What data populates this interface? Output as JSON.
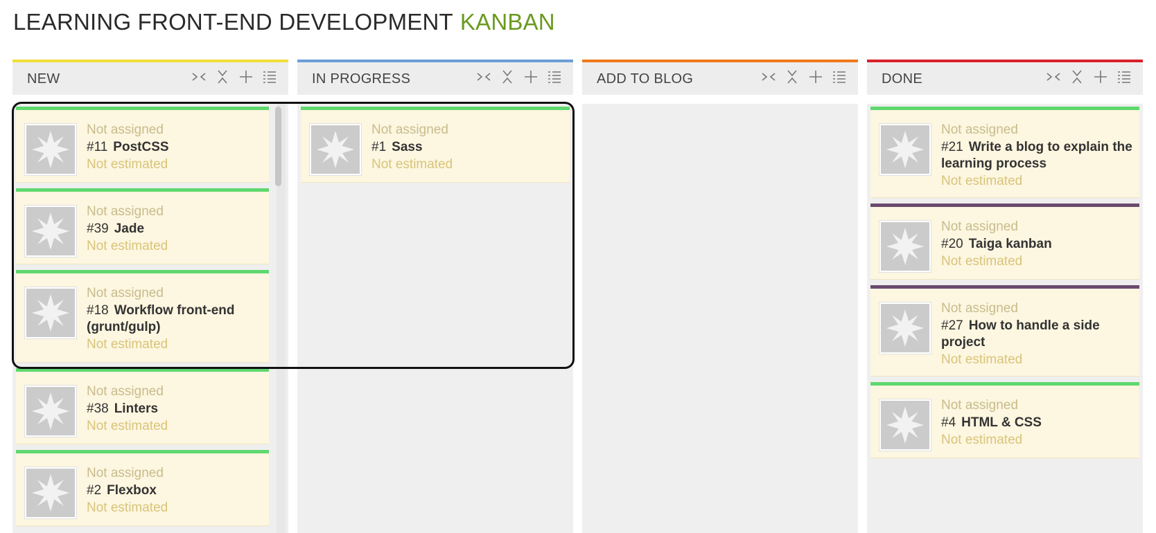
{
  "page": {
    "title": "LEARNING FRONT-END DEVELOPMENT",
    "title_accent": "KANBAN",
    "accent_color": "#6a9a1f"
  },
  "columns": [
    {
      "title": "NEW",
      "color": "#f2de3a",
      "cards": [
        {
          "assigned": "Not assigned",
          "ref": "#11",
          "name": "PostCSS",
          "estimate": "Not estimated",
          "tag_color": "#5fd86e"
        },
        {
          "assigned": "Not assigned",
          "ref": "#39",
          "name": "Jade",
          "estimate": "Not estimated",
          "tag_color": "#5fd86e"
        },
        {
          "assigned": "Not assigned",
          "ref": "#18",
          "name": "Workflow front-end (grunt/gulp)",
          "estimate": "Not estimated",
          "tag_color": "#5fd86e"
        },
        {
          "assigned": "Not assigned",
          "ref": "#38",
          "name": "Linters",
          "estimate": "Not estimated",
          "tag_color": "#5fd86e"
        },
        {
          "assigned": "Not assigned",
          "ref": "#2",
          "name": "Flexbox",
          "estimate": "Not estimated",
          "tag_color": "#5fd86e"
        }
      ]
    },
    {
      "title": "IN PROGRESS",
      "color": "#6b9ed8",
      "cards": [
        {
          "assigned": "Not assigned",
          "ref": "#1",
          "name": "Sass",
          "estimate": "Not estimated",
          "tag_color": "#5fd86e"
        }
      ]
    },
    {
      "title": "ADD TO BLOG",
      "color": "#f07a1a",
      "cards": []
    },
    {
      "title": "DONE",
      "color": "#d9202a",
      "cards": [
        {
          "assigned": "Not assigned",
          "ref": "#21",
          "name": "Write a blog to explain the learning process",
          "estimate": "Not estimated",
          "tag_color": "#5fd86e"
        },
        {
          "assigned": "Not assigned",
          "ref": "#20",
          "name": "Taiga kanban",
          "estimate": "Not estimated",
          "tag_color": "#6b4a6e"
        },
        {
          "assigned": "Not assigned",
          "ref": "#27",
          "name": "How to handle a side project",
          "estimate": "Not estimated",
          "tag_color": "#6b4a6e"
        },
        {
          "assigned": "Not assigned",
          "ref": "#4",
          "name": "HTML & CSS",
          "estimate": "Not estimated",
          "tag_color": "#5fd86e"
        }
      ]
    }
  ],
  "icons": {
    "fold": "fold-icon",
    "collapse": "collapse-icon",
    "add": "add-icon",
    "bulk": "bulk-add-icon",
    "avatar": "avatar-placeholder-icon"
  }
}
